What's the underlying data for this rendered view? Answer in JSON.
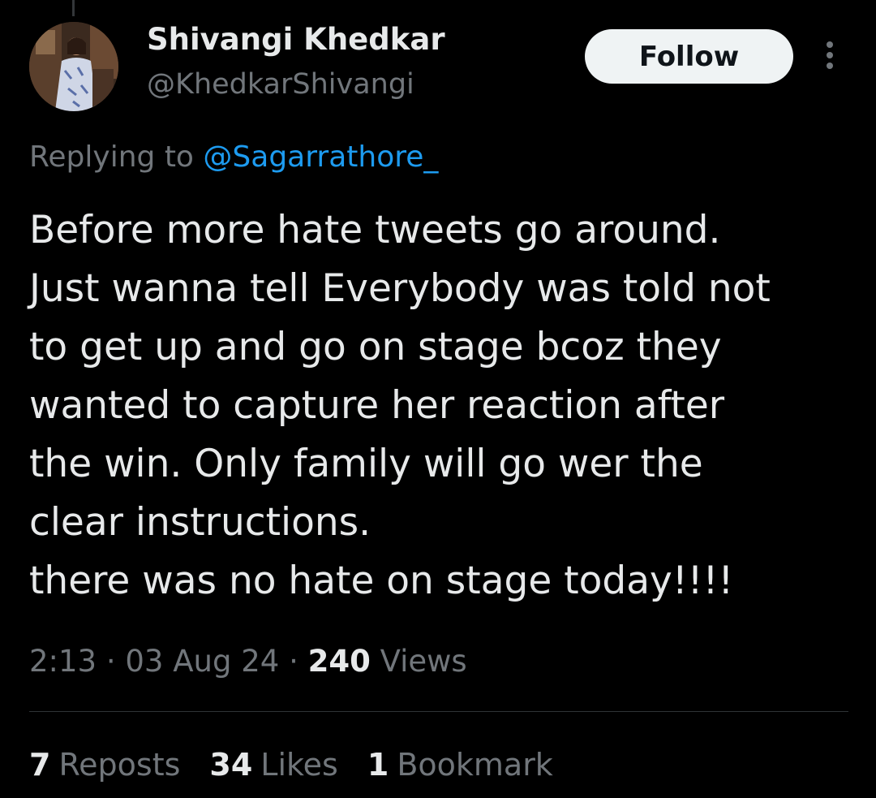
{
  "user": {
    "display_name": "Shivangi Khedkar",
    "handle": "@KhedkarShivangi",
    "avatar_icon": "profile-photo"
  },
  "header": {
    "follow_label": "Follow",
    "more_icon": "more-vertical-icon"
  },
  "reply": {
    "prefix": "Replying to",
    "mention": "@Sagarrathore_"
  },
  "tweet": {
    "lines": [
      "Before more hate tweets go around.",
      "Just wanna tell Everybody was told not",
      "to get up and go on stage bcoz they",
      "wanted to capture her reaction after",
      "the win. Only family will go wer the",
      "clear instructions.",
      "there was no hate on stage today!!!!"
    ]
  },
  "meta": {
    "time": "2:13",
    "separator": "·",
    "date": "03 Aug 24",
    "views_count": "240",
    "views_label": "Views"
  },
  "stats": {
    "reposts_count": "7",
    "reposts_label": "Reposts",
    "likes_count": "34",
    "likes_label": "Likes",
    "bookmarks_count": "1",
    "bookmarks_label": "Bookmark"
  },
  "colors": {
    "background": "#000000",
    "text_primary": "#e7e9ea",
    "text_secondary": "#71767b",
    "accent": "#1d9bf0",
    "follow_bg": "#eff3f4"
  }
}
